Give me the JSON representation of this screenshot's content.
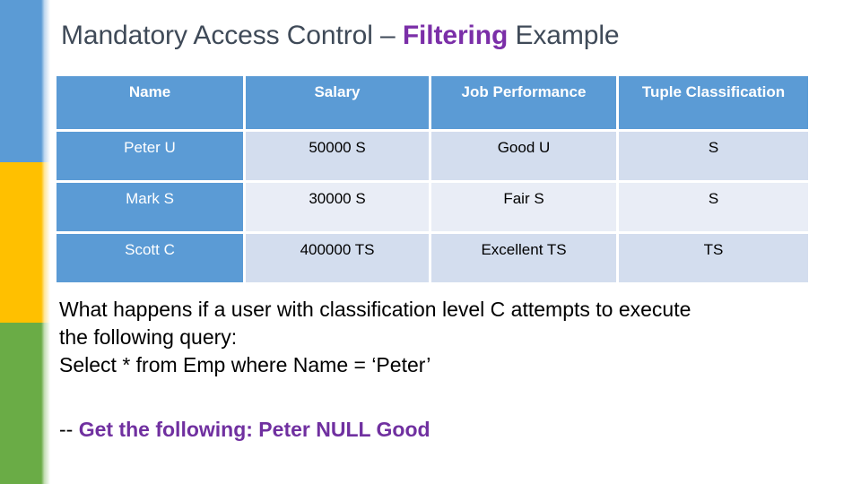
{
  "slide": {
    "title": {
      "before": "Mandatory Access Control – ",
      "accent": "Filtering",
      "after": " Example"
    }
  },
  "decor": {
    "bands": [
      {
        "name": "blue-band",
        "color": "#5b9bd5"
      },
      {
        "name": "yellow-band",
        "color": "#ffc000"
      },
      {
        "name": "green-band",
        "color": "#6aac46"
      }
    ]
  },
  "table": {
    "headers": [
      "Name",
      "Salary",
      "Job Performance",
      "Tuple Classification"
    ],
    "rows": [
      {
        "name": "Peter   U",
        "salary": "50000  S",
        "job": "Good   U",
        "tuple": "S"
      },
      {
        "name": "Mark   S",
        "salary": "30000  S",
        "job": "Fair     S",
        "tuple": "S"
      },
      {
        "name": "Scott   C",
        "salary": "400000  TS",
        "job": "Excellent   TS",
        "tuple": "TS"
      }
    ],
    "colors": {
      "header_bg": "#5b9bd5",
      "header_fg": "#ffffff",
      "name_bg": "#5b9bd5",
      "name_fg": "#ffffff",
      "row_a_bg": "#d3ddee",
      "row_b_bg": "#e9edf6"
    }
  },
  "question": {
    "line1": "What happens if a user with classification level C attempts to execute",
    "line2": "the following query:",
    "line3": "Select * from Emp where Name = ‘Peter’"
  },
  "result": {
    "prefix": "-- ",
    "accent": "Get the following:  Peter  NULL  Good",
    "accent_color": "#7030a0"
  }
}
